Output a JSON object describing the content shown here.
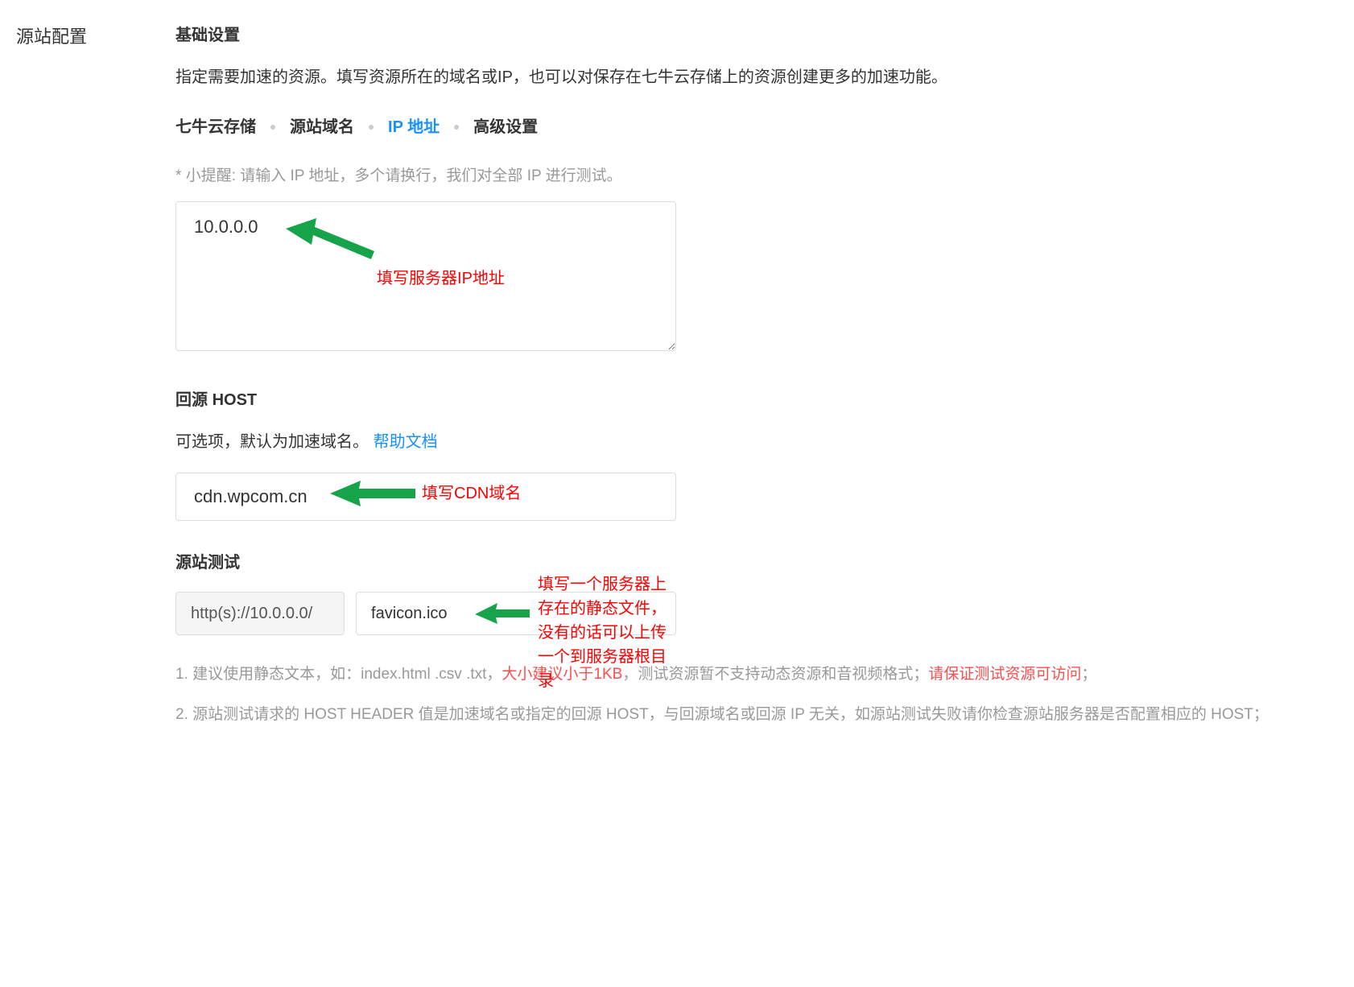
{
  "leftLabel": "源站配置",
  "basic": {
    "title": "基础设置",
    "description": "指定需要加速的资源。填写资源所在的域名或IP，也可以对保存在七牛云存储上的资源创建更多的加速功能。"
  },
  "tabs": {
    "storage": "七牛云存储",
    "domain": "源站域名",
    "ip": "IP 地址",
    "advanced": "高级设置"
  },
  "ipHint": "* 小提醒: 请输入 IP 地址，多个请换行，我们对全部 IP 进行测试。",
  "ipValue": "10.0.0.0",
  "annotations": {
    "ip": "填写服务器IP地址",
    "cdn": "填写CDN域名",
    "test1": "填写一个服务器上存在的静态文件，",
    "test2": "没有的话可以上传一个到服务器根目录"
  },
  "host": {
    "title": "回源 HOST",
    "descPrefix": "可选项，默认为加速域名。 ",
    "helpLink": "帮助文档",
    "value": "cdn.wpcom.cn"
  },
  "test": {
    "title": "源站测试",
    "prefix": "http(s)://10.0.0.0/",
    "value": "favicon.ico"
  },
  "notes": {
    "n1a": "1. 建议使用静态文本，如：index.html .csv .txt，",
    "n1b": "大小建议小于1KB",
    "n1c": "，测试资源暂不支持动态资源和音视频格式；",
    "n1d": "请保证测试资源可访问",
    "n1e": "；",
    "n2": "2. 源站测试请求的 HOST HEADER 值是加速域名或指定的回源 HOST，与回源域名或回源 IP 无关，如源站测试失败请你检查源站服务器是否配置相应的 HOST；"
  }
}
